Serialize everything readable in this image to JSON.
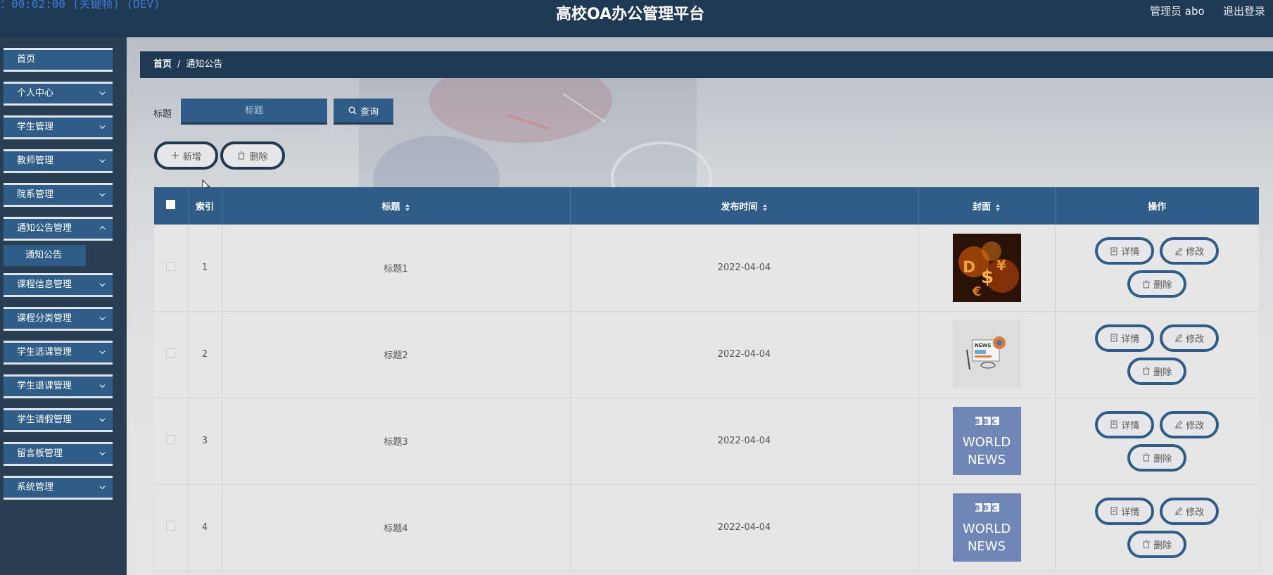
{
  "header": {
    "time_text": "：00:02:00 (关键帧) (DEV)",
    "title": "高校OA办公管理平台",
    "user": "管理员 abo",
    "logout": "退出登录"
  },
  "sidebar": {
    "items": [
      {
        "label": "首页"
      },
      {
        "label": "个人中心"
      },
      {
        "label": "学生管理"
      },
      {
        "label": "教师管理"
      },
      {
        "label": "院系管理"
      },
      {
        "label": "通知公告管理"
      },
      {
        "label": "课程信息管理"
      },
      {
        "label": "课程分类管理"
      },
      {
        "label": "学生选课管理"
      },
      {
        "label": "学生退课管理"
      },
      {
        "label": "学生请假管理"
      },
      {
        "label": "留言板管理"
      },
      {
        "label": "系统管理"
      }
    ],
    "submenu": {
      "label": "通知公告"
    }
  },
  "breadcrumb": {
    "home": "首页",
    "separator": "/",
    "current": "通知公告"
  },
  "search": {
    "label": "标题",
    "placeholder": "标题",
    "button": "查询"
  },
  "actions": {
    "add": "新增",
    "delete": "删除"
  },
  "table": {
    "headers": {
      "index": "索引",
      "title": "标题",
      "publish_time": "发布时间",
      "cover": "封面",
      "ops": "操作"
    },
    "rows": [
      {
        "index": "1",
        "title": "标题1",
        "time": "2022-04-04",
        "cover": "money-symbols"
      },
      {
        "index": "2",
        "title": "标题2",
        "time": "2022-04-04",
        "cover": "news-illustration"
      },
      {
        "index": "3",
        "title": "标题3",
        "time": "2022-04-04",
        "cover": "bbc-world-news"
      },
      {
        "index": "4",
        "title": "标题4",
        "time": "2022-04-04",
        "cover": "bbc-world-news"
      }
    ],
    "op_labels": {
      "detail": "详情",
      "edit": "修改",
      "delete": "删除"
    },
    "cover_text": {
      "bbc": "BBC",
      "world": "WORLD",
      "news": "NEWS",
      "news_small": "NEWS"
    }
  },
  "colors": {
    "header_bg": "#1f3a52",
    "accent": "#2f5d88",
    "main_bg": "#e4e4e4"
  }
}
